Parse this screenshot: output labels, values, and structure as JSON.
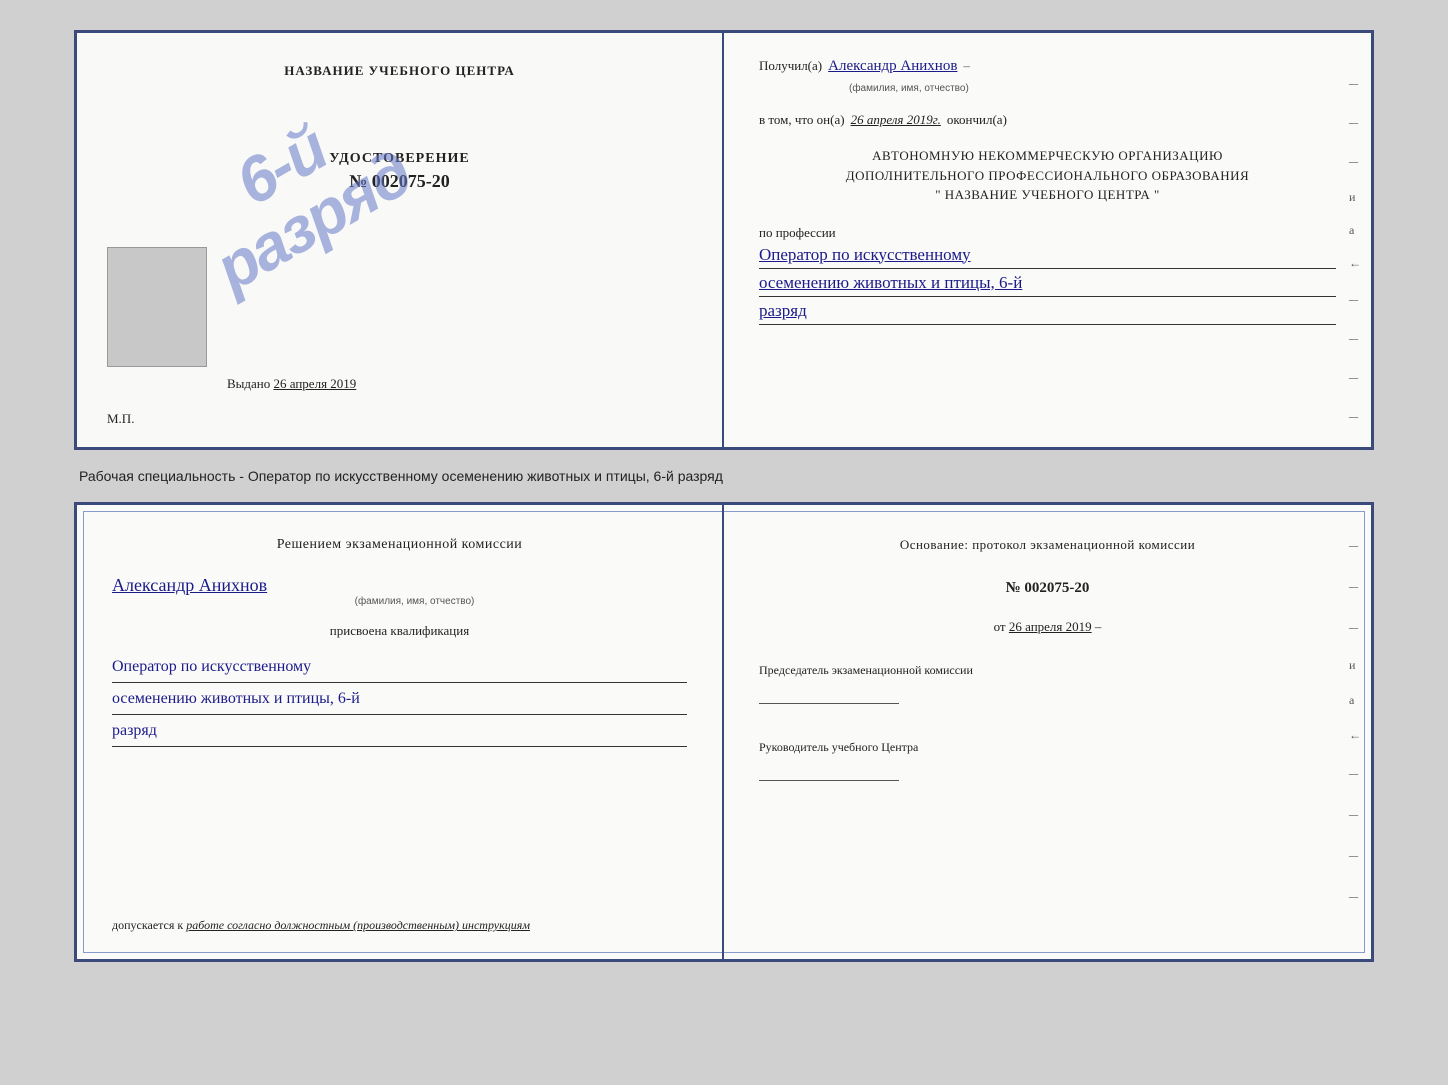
{
  "page": {
    "background": "#d0d0d0"
  },
  "top_cert": {
    "left": {
      "title": "НАЗВАНИЕ УЧЕБНОГО ЦЕНТРА",
      "udostoverenie_label": "УДОСТОВЕРЕНИЕ",
      "number": "№ 002075-20",
      "vydano_label": "Выдано",
      "vydano_date": "26 апреля 2019",
      "mp_label": "М.П."
    },
    "stamp": {
      "line1": "6-й",
      "line2": "разряд"
    },
    "right": {
      "poluchil_label": "Получил(a)",
      "poluchil_name": "Александр Анихнов",
      "poluchil_sub": "(фамилия, имя, отчество)",
      "vtom_label": "в том, что он(а)",
      "vtom_date": "26 апреля 2019г.",
      "okonchil_label": "окончил(а)",
      "org_line1": "АВТОНОМНУЮ НЕКОММЕРЧЕСКУЮ ОРГАНИЗАЦИЮ",
      "org_line2": "ДОПОЛНИТЕЛЬНОГО ПРОФЕССИОНАЛЬНОГО ОБРАЗОВАНИЯ",
      "org_line3": "\"   НАЗВАНИЕ УЧЕБНОГО ЦЕНТРА   \"",
      "poprofessii_label": "по профессии",
      "profession_line1": "Оператор по искусственному",
      "profession_line2": "осеменению животных и птицы, 6-й",
      "profession_line3": "разряд"
    }
  },
  "description": "Рабочая специальность - Оператор по искусственному осеменению животных и птицы, 6-й разряд",
  "bottom_cert": {
    "left": {
      "resheniem_label": "Решением экзаменационной комиссии",
      "name": "Александр Анихнов",
      "name_sub": "(фамилия, имя, отчество)",
      "prisvoena_label": "присвоена квалификация",
      "kvalifikaciya_line1": "Оператор по искусственному",
      "kvalifikaciya_line2": "осеменению животных и птицы, 6-й",
      "kvalifikaciya_line3": "разряд",
      "dopuskaetsya_label": "допускается к",
      "dopuskaetsya_text": "работе согласно должностным (производственным) инструкциям"
    },
    "right": {
      "osnovanie_label": "Основание: протокол экзаменационной комиссии",
      "number_label": "№  002075-20",
      "ot_label": "от",
      "ot_date": "26 апреля 2019",
      "predsedatel_label": "Председатель экзаменационной комиссии",
      "rukovoditel_label": "Руководитель учебного Центра"
    }
  }
}
